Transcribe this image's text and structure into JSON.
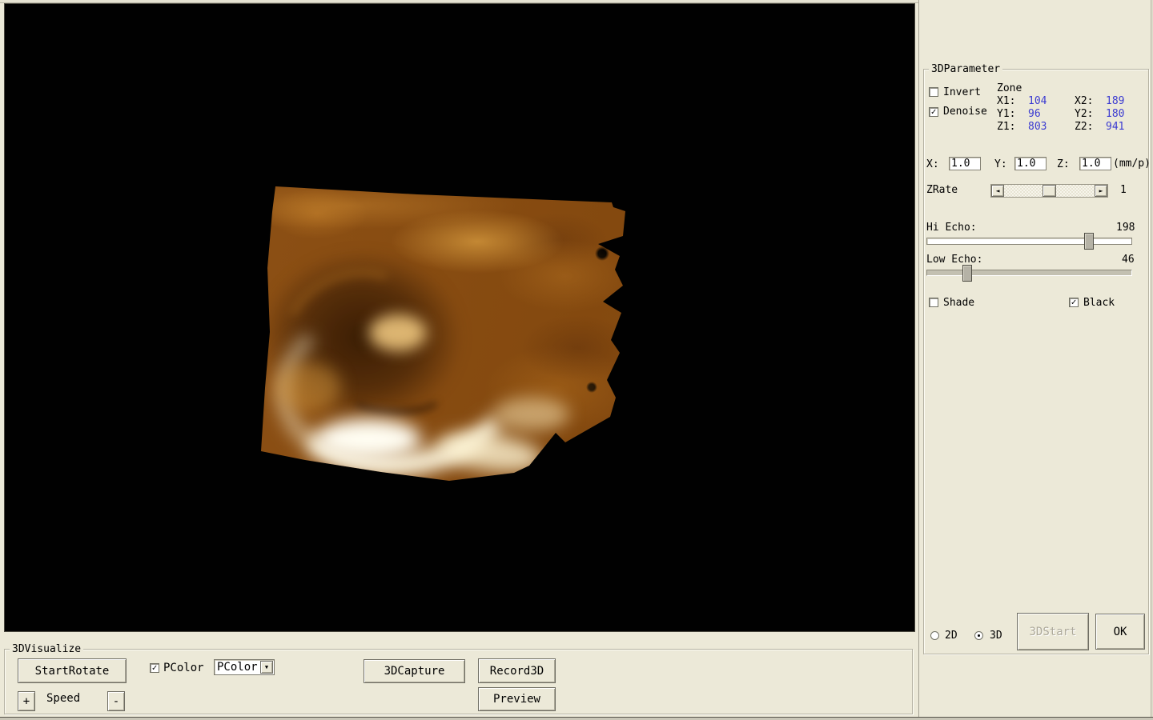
{
  "icons": {
    "check": "✓",
    "dropdown_arrow": "▼",
    "scroll_left": "◄",
    "scroll_right": "►"
  },
  "viewport": {
    "content": "3D ultrasound volume rendering, amber/sepia tones with bright echogenic crescent"
  },
  "parameter_panel": {
    "title": "3DParameter",
    "invert": {
      "label": "Invert",
      "checked": false
    },
    "denoise": {
      "label": "Denoise",
      "checked": true
    },
    "zone": {
      "label": "Zone",
      "value_color": "#3b3bd1",
      "x1_label": "X1:",
      "x1": "104",
      "x2_label": "X2:",
      "x2": "189",
      "y1_label": "Y1:",
      "y1": "96",
      "y2_label": "Y2:",
      "y2": "180",
      "z1_label": "Z1:",
      "z1": "803",
      "z2_label": "Z2:",
      "z2": "941"
    },
    "scale": {
      "x_label": "X:",
      "x_value": "1.0",
      "y_label": "Y:",
      "y_value": "1.0",
      "z_label": "Z:",
      "z_value": "1.0",
      "unit": "(mm/p)"
    },
    "zrate": {
      "label": "ZRate",
      "value": "1"
    },
    "hi_echo": {
      "label": "Hi Echo:",
      "value": "198"
    },
    "low_echo": {
      "label": "Low Echo:",
      "value": "46"
    },
    "shade": {
      "label": "Shade",
      "checked": false
    },
    "black": {
      "label": "Black",
      "checked": true
    },
    "mode_2d": {
      "label": "2D",
      "selected": false
    },
    "mode_3d": {
      "label": "3D",
      "selected": true
    },
    "start_button": "3DStart",
    "ok_button": "OK"
  },
  "visualize_panel": {
    "title": "3DVisualize",
    "start_rotate_button": "StartRotate",
    "pcolor_checkbox": {
      "label": "PColor",
      "checked": true
    },
    "pcolor_dropdown": {
      "value": "PColor"
    },
    "capture_button": "3DCapture",
    "record_button": "Record3D",
    "preview_button": "Preview",
    "speed": {
      "label": "Speed",
      "plus": "+",
      "minus": "-"
    }
  }
}
